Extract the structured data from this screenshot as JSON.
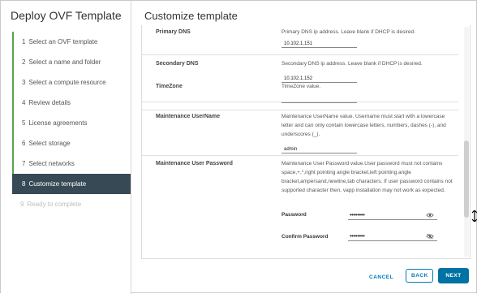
{
  "sidebar": {
    "title": "Deploy OVF Template",
    "steps": [
      {
        "num": "1",
        "label": "Select an OVF template",
        "state": "done"
      },
      {
        "num": "2",
        "label": "Select a name and folder",
        "state": "done"
      },
      {
        "num": "3",
        "label": "Select a compute resource",
        "state": "done"
      },
      {
        "num": "4",
        "label": "Review details",
        "state": "done"
      },
      {
        "num": "5",
        "label": "License agreements",
        "state": "done"
      },
      {
        "num": "6",
        "label": "Select storage",
        "state": "done"
      },
      {
        "num": "7",
        "label": "Select networks",
        "state": "done"
      },
      {
        "num": "8",
        "label": "Customize template",
        "state": "active"
      },
      {
        "num": "9",
        "label": "Ready to complete",
        "state": "future"
      }
    ]
  },
  "main": {
    "title": "Customize template",
    "fields": {
      "primary_dns": {
        "label": "Primary DNS",
        "description": "Primary DNS ip address. Leave blank if DHCP is desired.",
        "value": "10.102.1.151"
      },
      "secondary_dns": {
        "label": "Secondary DNS",
        "description": "Secondary DNS ip address. Leave blank if DHCP is desired.",
        "value": "10.102.1.152"
      },
      "timezone": {
        "label": "TimeZone",
        "description": "TimeZone value.",
        "value": ""
      },
      "maint_username": {
        "label": "Maintenance UserName",
        "description": "Maintenance UserName value. Username must start with a lowercase letter and can only contain lowercase letters, numbers, dashes (-), and underscores (_).",
        "value": "admin"
      },
      "maint_password": {
        "label": "Maintenance User Password",
        "description": "Maintenance User Password value.User password must not contains space,+,*,right pointing angle bracket,left pointing angle bracket,ampersand,newline,tab characters. If user password contains not supported character then, vapp installation may not work as expected.",
        "password_label": "Password",
        "password_value": "••••••••",
        "confirm_label": "Confirm Password",
        "confirm_value": "••••••••"
      }
    }
  },
  "footer": {
    "cancel": "CANCEL",
    "back": "BACK",
    "next": "NEXT"
  },
  "colors": {
    "accent": "#0072a3",
    "active_step_bg": "#364955",
    "done_step_bar": "#5aa34a"
  },
  "icons": [
    "eye-icon",
    "eye-slash-icon",
    "cursor-icon"
  ]
}
